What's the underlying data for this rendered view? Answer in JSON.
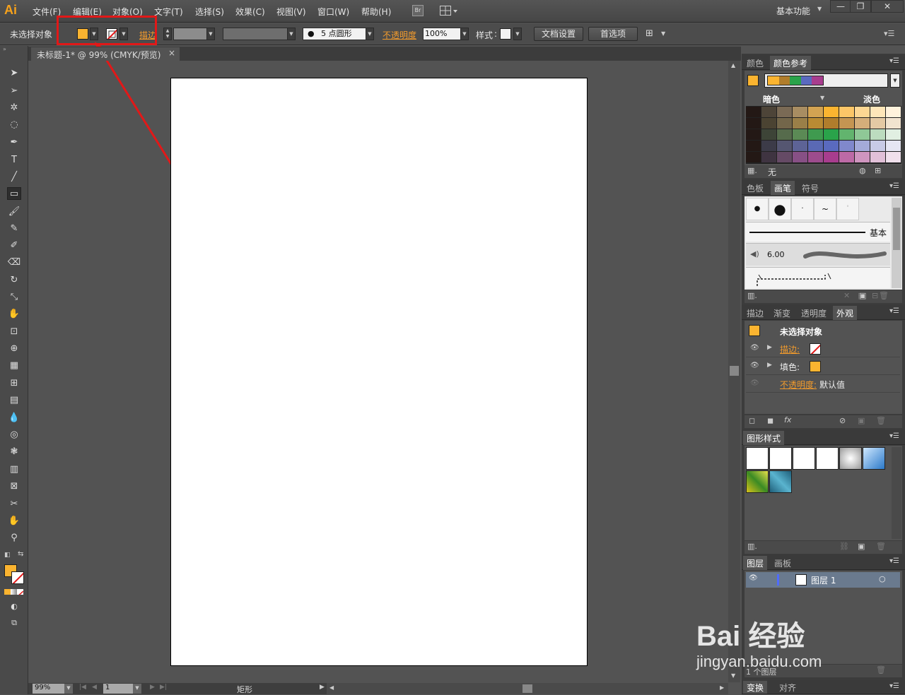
{
  "app": {
    "logo": "Ai",
    "workspace": "基本功能"
  },
  "menu": [
    "文件(F)",
    "编辑(E)",
    "对象(O)",
    "文字(T)",
    "选择(S)",
    "效果(C)",
    "视图(V)",
    "窗口(W)",
    "帮助(H)"
  ],
  "bridge": "Br",
  "control": {
    "selection": "未选择对象",
    "stroke_label": "描边",
    "brush_size": "5",
    "brush_name": "点圆形",
    "opacity_label": "不透明度",
    "opacity_value": "100%",
    "style_label": "样式",
    "doc_setup": "文档设置",
    "preferences": "首选项"
  },
  "document": {
    "tab_title": "未标题-1* @ 99% (CMYK/预览)",
    "tab_close": "×"
  },
  "status": {
    "zoom": "99%",
    "artboard": "1",
    "tool": "矩形"
  },
  "colors": {
    "fill": "#fbb430",
    "accent": "#f29b2c",
    "highlight": "#e21818"
  },
  "color_panel": {
    "tabs": [
      "颜色",
      "颜色参考"
    ],
    "dark_label": "暗色",
    "light_label": "淡色",
    "footer_label": "无",
    "harmony": [
      "#fbb430",
      "#b07d2c",
      "#2aa34a",
      "#5a6abf",
      "#a83d8e"
    ],
    "grid": [
      [
        "#231815",
        "#4d4438",
        "#7a6a55",
        "#a88d62",
        "#d3a352",
        "#fbb430",
        "#fcc668",
        "#fdd793",
        "#fee6b9",
        "#fff2dc"
      ],
      [
        "#231815",
        "#4b4332",
        "#73664a",
        "#9a7f48",
        "#b98b33",
        "#b07d2c",
        "#c49552",
        "#d4ae7a",
        "#e4c9a4",
        "#f1e3cf"
      ],
      [
        "#231815",
        "#3d4437",
        "#566b4c",
        "#5b8a55",
        "#3f9a4f",
        "#2aa34a",
        "#62b46e",
        "#8fc897",
        "#bcdcbf",
        "#e1efe2"
      ],
      [
        "#231815",
        "#3c3b48",
        "#555671",
        "#5d6396",
        "#5a69b4",
        "#5a6abf",
        "#8088cc",
        "#a4aad9",
        "#c8cbe6",
        "#e5e6f3"
      ],
      [
        "#231815",
        "#3f3441",
        "#654a65",
        "#875085",
        "#9d4c8d",
        "#a83d8e",
        "#bd6aa6",
        "#cf95bf",
        "#e1c0d8",
        "#f0e0ec"
      ]
    ]
  },
  "brush_panel": {
    "tabs": [
      "色板",
      "画笔",
      "符号"
    ],
    "basic_label": "基本",
    "size_label": "6.00"
  },
  "appearance_panel": {
    "tabs": [
      "描边",
      "渐变",
      "透明度",
      "外观"
    ],
    "title": "未选择对象",
    "stroke_label": "描边:",
    "fill_label": "填色:",
    "opacity_label": "不透明度:",
    "opacity_value": "默认值",
    "fx": "fx"
  },
  "graphic_styles": {
    "tab": "图形样式"
  },
  "layers_panel": {
    "tabs": [
      "图层",
      "画板"
    ],
    "layer_name": "图层 1",
    "footer": "1 个图层"
  },
  "bottom_panel": {
    "tabs": [
      "变换",
      "对齐"
    ]
  },
  "watermark": {
    "brand": "Bai 经验",
    "url": "jingyan.baidu.com"
  }
}
